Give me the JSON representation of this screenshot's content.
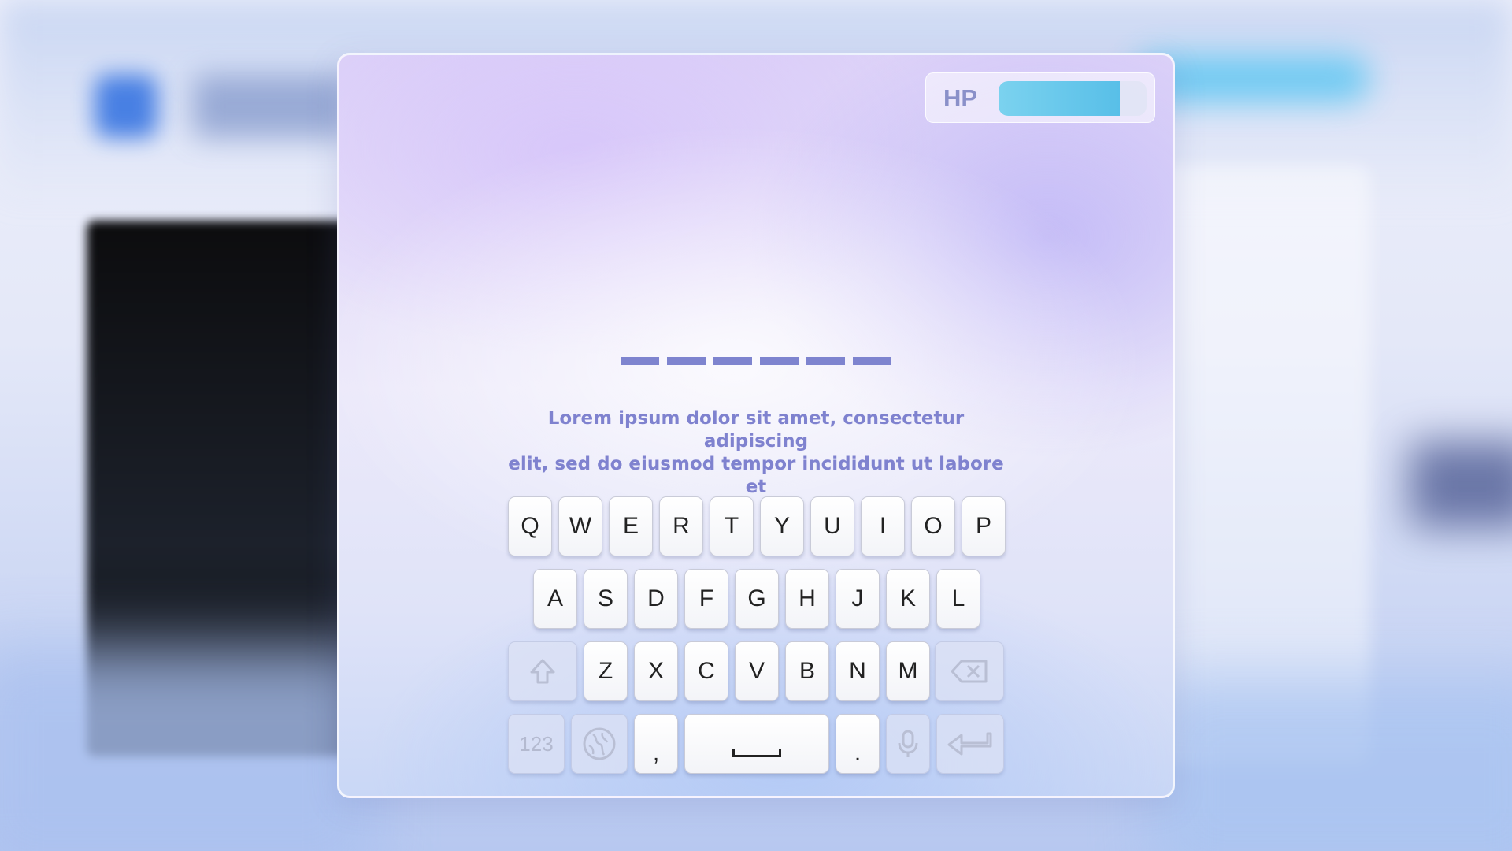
{
  "hud": {
    "hp_label": "HP",
    "hp_fraction": 0.82,
    "hp_color": "#58bfe8"
  },
  "word": {
    "blank_count": 6
  },
  "prompt": {
    "line1": "Lorem ipsum dolor sit amet, consectetur adipiscing",
    "line2": "elit, sed do eiusmod tempor incididunt ut labore et"
  },
  "keyboard": {
    "row1": [
      "Q",
      "W",
      "E",
      "R",
      "T",
      "Y",
      "U",
      "I",
      "O",
      "P"
    ],
    "row2": [
      "A",
      "S",
      "D",
      "F",
      "G",
      "H",
      "J",
      "K",
      "L"
    ],
    "row3": [
      "Z",
      "X",
      "C",
      "V",
      "B",
      "N",
      "M"
    ],
    "numbers_label": "123",
    "comma": ",",
    "period": ".",
    "icons": {
      "shift": "shift-arrow-icon",
      "backspace": "backspace-icon",
      "globe": "globe-icon",
      "microphone": "microphone-icon",
      "enter": "return-arrow-icon",
      "space": "space-bar-icon"
    }
  }
}
